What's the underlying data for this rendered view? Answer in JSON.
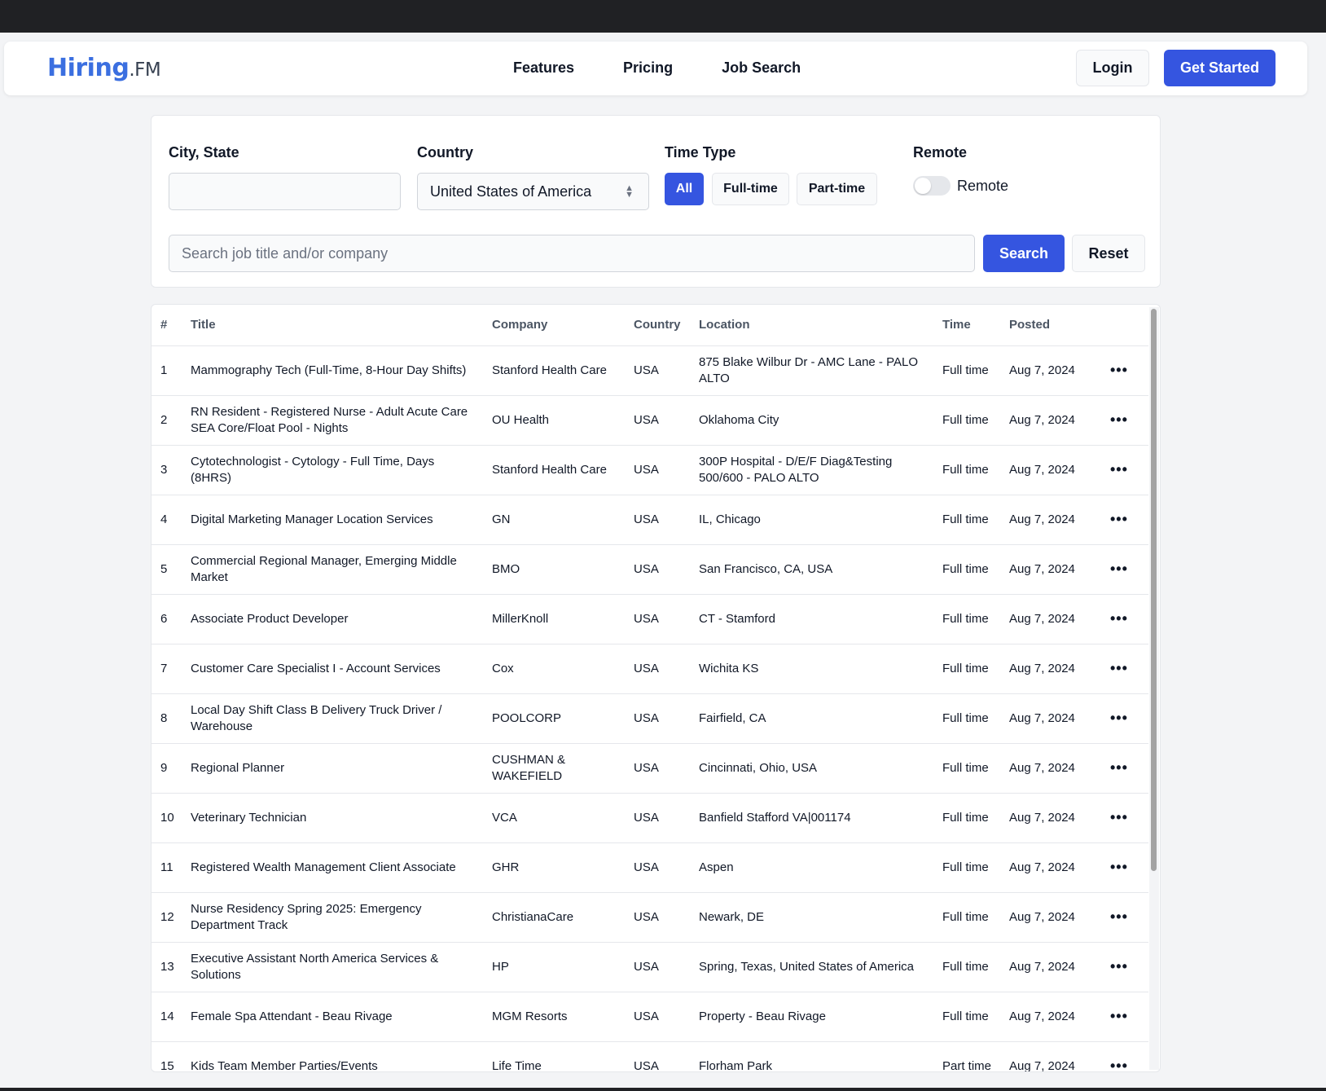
{
  "brand": {
    "name": "Hiring",
    "suffix": ".FM"
  },
  "nav": {
    "links": [
      "Features",
      "Pricing",
      "Job Search"
    ],
    "login": "Login",
    "get_started": "Get Started"
  },
  "filters": {
    "city_label": "City, State",
    "city_value": "",
    "country_label": "Country",
    "country_value": "United States of America",
    "time_type_label": "Time Type",
    "time_types": [
      "All",
      "Full-time",
      "Part-time"
    ],
    "time_type_selected": "All",
    "remote_label": "Remote",
    "remote_toggle_label": "Remote",
    "remote_on": false,
    "search_placeholder": "Search job title and/or company",
    "search_button": "Search",
    "reset_button": "Reset"
  },
  "table": {
    "headers": [
      "#",
      "Title",
      "Company",
      "Country",
      "Location",
      "Time",
      "Posted"
    ],
    "rows": [
      {
        "n": "1",
        "title": "Mammography Tech (Full-Time, 8-Hour Day Shifts)",
        "company": "Stanford Health Care",
        "country": "USA",
        "location": "875 Blake Wilbur Dr - AMC Lane - PALO ALTO",
        "time": "Full time",
        "posted": "Aug 7, 2024"
      },
      {
        "n": "2",
        "title": "RN Resident - Registered Nurse - Adult Acute Care SEA Core/Float Pool - Nights",
        "company": "OU Health",
        "country": "USA",
        "location": "Oklahoma City",
        "time": "Full time",
        "posted": "Aug 7, 2024"
      },
      {
        "n": "3",
        "title": "Cytotechnologist - Cytology - Full Time, Days (8HRS)",
        "company": "Stanford Health Care",
        "country": "USA",
        "location": "300P Hospital - D/E/F Diag&Testing 500/600 - PALO ALTO",
        "time": "Full time",
        "posted": "Aug 7, 2024"
      },
      {
        "n": "4",
        "title": "Digital Marketing Manager Location Services",
        "company": "GN",
        "country": "USA",
        "location": "IL, Chicago",
        "time": "Full time",
        "posted": "Aug 7, 2024"
      },
      {
        "n": "5",
        "title": "Commercial Regional Manager, Emerging Middle Market",
        "company": "BMO",
        "country": "USA",
        "location": "San Francisco, CA, USA",
        "time": "Full time",
        "posted": "Aug 7, 2024"
      },
      {
        "n": "6",
        "title": "Associate Product Developer",
        "company": "MillerKnoll",
        "country": "USA",
        "location": "CT - Stamford",
        "time": "Full time",
        "posted": "Aug 7, 2024"
      },
      {
        "n": "7",
        "title": "Customer Care Specialist I - Account Services",
        "company": "Cox",
        "country": "USA",
        "location": "Wichita KS",
        "time": "Full time",
        "posted": "Aug 7, 2024"
      },
      {
        "n": "8",
        "title": "Local Day Shift Class B Delivery Truck Driver / Warehouse",
        "company": "POOLCORP",
        "country": "USA",
        "location": "Fairfield, CA",
        "time": "Full time",
        "posted": "Aug 7, 2024"
      },
      {
        "n": "9",
        "title": "Regional Planner",
        "company": "CUSHMAN & WAKEFIELD",
        "country": "USA",
        "location": "Cincinnati, Ohio, USA",
        "time": "Full time",
        "posted": "Aug 7, 2024"
      },
      {
        "n": "10",
        "title": "Veterinary Technician",
        "company": "VCA",
        "country": "USA",
        "location": "Banfield Stafford VA|001174",
        "time": "Full time",
        "posted": "Aug 7, 2024"
      },
      {
        "n": "11",
        "title": "Registered Wealth Management Client Associate",
        "company": "GHR",
        "country": "USA",
        "location": "Aspen",
        "time": "Full time",
        "posted": "Aug 7, 2024"
      },
      {
        "n": "12",
        "title": "Nurse Residency Spring 2025: Emergency Department Track",
        "company": "ChristianaCare",
        "country": "USA",
        "location": "Newark, DE",
        "time": "Full time",
        "posted": "Aug 7, 2024"
      },
      {
        "n": "13",
        "title": "Executive Assistant North America Services & Solutions",
        "company": "HP",
        "country": "USA",
        "location": "Spring, Texas, United States of America",
        "time": "Full time",
        "posted": "Aug 7, 2024"
      },
      {
        "n": "14",
        "title": "Female Spa Attendant - Beau Rivage",
        "company": "MGM Resorts",
        "country": "USA",
        "location": "Property - Beau Rivage",
        "time": "Full time",
        "posted": "Aug 7, 2024"
      },
      {
        "n": "15",
        "title": "Kids Team Member Parties/Events",
        "company": "Life Time",
        "country": "USA",
        "location": "Florham Park",
        "time": "Part time",
        "posted": "Aug 7, 2024"
      }
    ]
  },
  "colors": {
    "accent": "#3555e0",
    "brand": "#3b6fe0"
  },
  "icons": {
    "row_menu": "more-horizontal-icon",
    "select": "chevron-up-down-icon"
  }
}
